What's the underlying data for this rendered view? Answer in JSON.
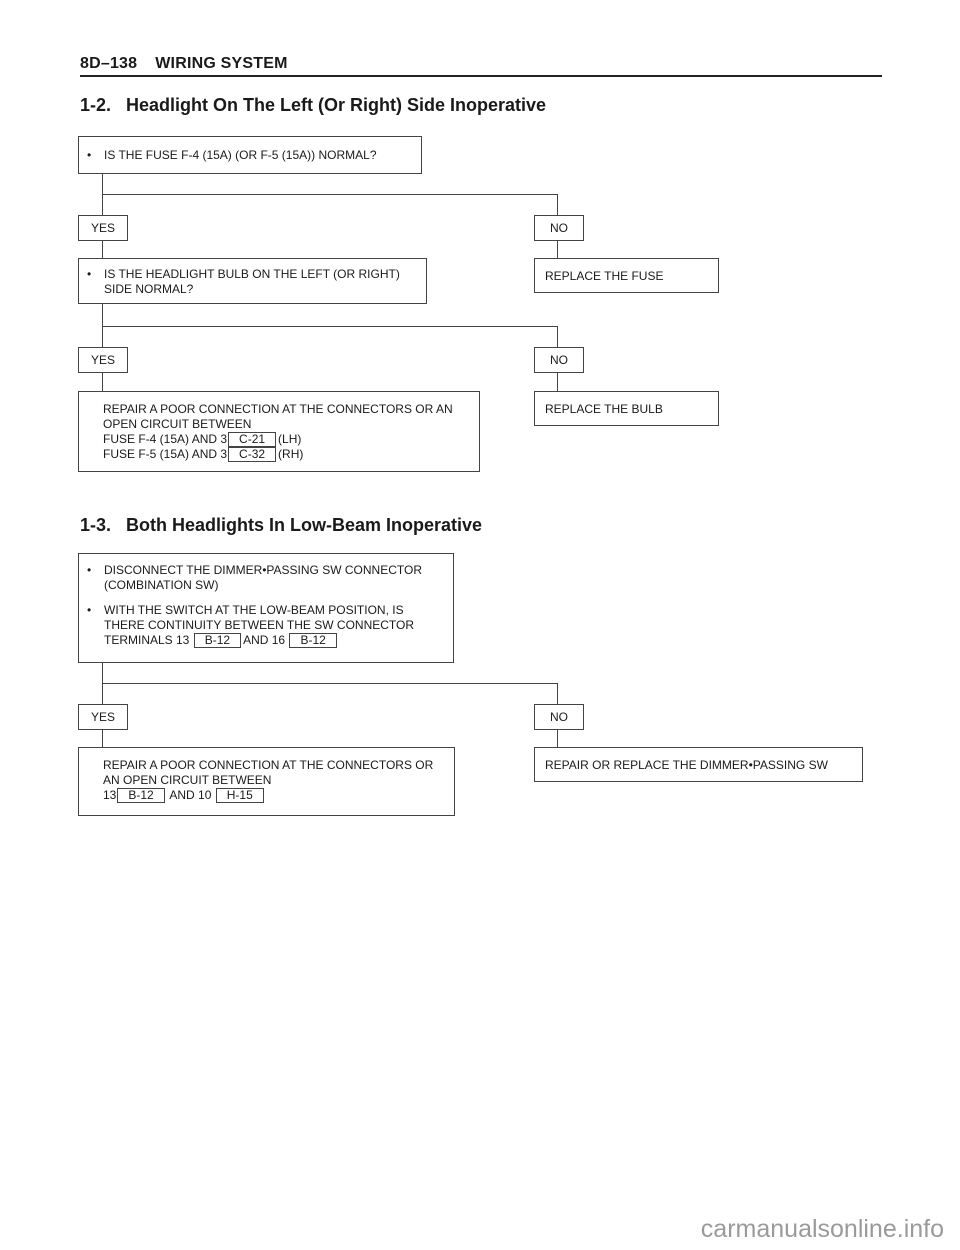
{
  "header": {
    "page_code": "8D–138",
    "section": "WIRING SYSTEM"
  },
  "sections": [
    {
      "title": "1-2.   Headlight On The Left (Or Right) Side Inoperative",
      "steps": {
        "q1": "IS THE FUSE F-4 (15A) (OR F-5 (15A)) NORMAL?",
        "yes1": "YES",
        "no1": "NO",
        "no1_action": "REPLACE THE FUSE",
        "q2_line1": "IS THE HEADLIGHT BULB ON THE LEFT (OR RIGHT)",
        "q2_line2": "SIDE NORMAL?",
        "yes2": "YES",
        "no2": "NO",
        "no2_action": "REPLACE THE BULB",
        "yes2_action": {
          "line1": "REPAIR A POOR CONNECTION AT THE CONNECTORS OR AN",
          "line2": "OPEN CIRCUIT BETWEEN",
          "line3_pre": "FUSE F-4 (15A) AND 3",
          "line3_conn": "C-21",
          "line3_post": "(LH)",
          "line4_pre": "FUSE F-5 (15A) AND 3",
          "line4_conn": "C-32",
          "line4_post": "(RH)"
        }
      }
    },
    {
      "title": "1-3.   Both Headlights In Low-Beam Inoperative",
      "steps": {
        "q1_b1_line1": "DISCONNECT THE DIMMER•PASSING SW CONNECTOR",
        "q1_b1_line2": "(COMBINATION SW)",
        "q1_b2_line1": "WITH THE SWITCH AT THE LOW-BEAM POSITION, IS",
        "q1_b2_line2": "THERE CONTINUITY BETWEEN THE SW CONNECTOR",
        "q1_b2_line3_pre": "TERMINALS 13",
        "q1_b2_conn1": "B-12",
        "q1_b2_mid": "AND 16",
        "q1_b2_conn2": "B-12",
        "yes": "YES",
        "no": "NO",
        "no_action": "REPAIR OR REPLACE THE DIMMER•PASSING SW",
        "yes_action": {
          "line1": "REPAIR A POOR CONNECTION AT THE CONNECTORS OR",
          "line2": "AN OPEN CIRCUIT BETWEEN",
          "line3_pre": "13",
          "line3_conn1": "B-12",
          "line3_mid": "AND 10",
          "line3_conn2": "H-15"
        }
      }
    }
  ],
  "watermark": "carmanualsonline.info"
}
